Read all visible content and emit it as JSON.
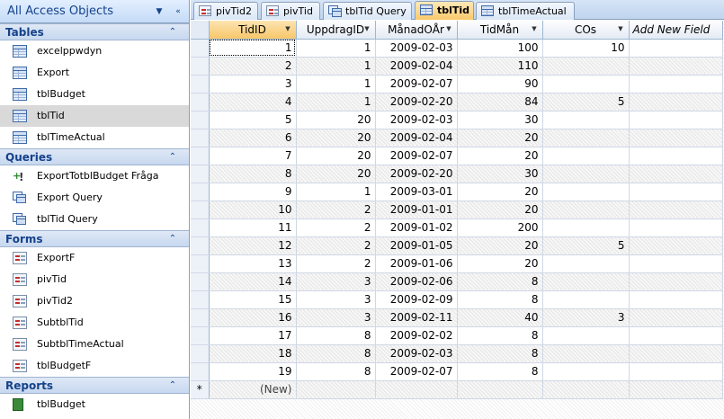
{
  "nav": {
    "title": "All Access Objects",
    "groups": [
      {
        "label": "Tables",
        "items": [
          {
            "label": "excelppwdyn",
            "icon": "table-icon"
          },
          {
            "label": "Export",
            "icon": "table-icon"
          },
          {
            "label": "tblBudget",
            "icon": "table-icon"
          },
          {
            "label": "tblTid",
            "icon": "table-icon",
            "selected": true
          },
          {
            "label": "tblTimeActual",
            "icon": "table-icon"
          }
        ]
      },
      {
        "label": "Queries",
        "items": [
          {
            "label": "ExportTotblBudget Fråga",
            "icon": "append-query-icon"
          },
          {
            "label": "Export Query",
            "icon": "select-query-icon"
          },
          {
            "label": "tblTid Query",
            "icon": "select-query-icon"
          }
        ]
      },
      {
        "label": "Forms",
        "items": [
          {
            "label": "ExportF",
            "icon": "form-icon"
          },
          {
            "label": "pivTid",
            "icon": "form-icon"
          },
          {
            "label": "pivTid2",
            "icon": "form-icon"
          },
          {
            "label": "SubtblTid",
            "icon": "form-icon"
          },
          {
            "label": "SubtblTimeActual",
            "icon": "form-icon"
          },
          {
            "label": "tblBudgetF",
            "icon": "form-icon"
          }
        ]
      },
      {
        "label": "Reports",
        "items": [
          {
            "label": "tblBudget",
            "icon": "report-icon"
          }
        ]
      }
    ]
  },
  "tabs": [
    {
      "label": "pivTid2",
      "icon": "form-icon"
    },
    {
      "label": "pivTid",
      "icon": "form-icon"
    },
    {
      "label": "tblTid Query",
      "icon": "select-query-icon"
    },
    {
      "label": "tblTid",
      "icon": "table-icon",
      "active": true
    },
    {
      "label": "tblTimeActual",
      "icon": "table-icon"
    }
  ],
  "datasheet": {
    "columns": [
      "TidID",
      "UppdragID",
      "MånadOÅr",
      "TidMån",
      "COs",
      "Add New Field"
    ],
    "rows": [
      [
        "1",
        "1",
        "2009-02-03",
        "100",
        "10"
      ],
      [
        "2",
        "1",
        "2009-02-04",
        "110",
        ""
      ],
      [
        "3",
        "1",
        "2009-02-07",
        "90",
        ""
      ],
      [
        "4",
        "1",
        "2009-02-20",
        "84",
        "5"
      ],
      [
        "5",
        "20",
        "2009-02-03",
        "30",
        ""
      ],
      [
        "6",
        "20",
        "2009-02-04",
        "20",
        ""
      ],
      [
        "7",
        "20",
        "2009-02-07",
        "20",
        ""
      ],
      [
        "8",
        "20",
        "2009-02-20",
        "30",
        ""
      ],
      [
        "9",
        "1",
        "2009-03-01",
        "20",
        ""
      ],
      [
        "10",
        "2",
        "2009-01-01",
        "20",
        ""
      ],
      [
        "11",
        "2",
        "2009-01-02",
        "200",
        ""
      ],
      [
        "12",
        "2",
        "2009-01-05",
        "20",
        "5"
      ],
      [
        "13",
        "2",
        "2009-01-06",
        "20",
        ""
      ],
      [
        "14",
        "3",
        "2009-02-06",
        "8",
        ""
      ],
      [
        "15",
        "3",
        "2009-02-09",
        "8",
        ""
      ],
      [
        "16",
        "3",
        "2009-02-11",
        "40",
        "3"
      ],
      [
        "17",
        "8",
        "2009-02-02",
        "8",
        ""
      ],
      [
        "18",
        "8",
        "2009-02-03",
        "8",
        ""
      ],
      [
        "19",
        "8",
        "2009-02-07",
        "8",
        ""
      ]
    ],
    "new_record_label": "(New)",
    "new_record_marker": "*"
  }
}
